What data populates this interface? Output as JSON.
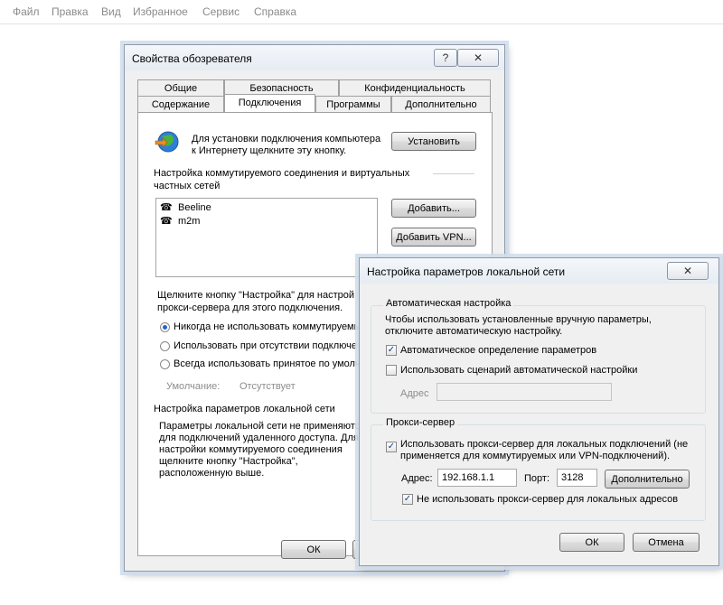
{
  "menu": [
    "Файл",
    "Правка",
    "Вид",
    "Избранное",
    "Сервис",
    "Справка"
  ],
  "main": {
    "title": "Свойства обозревателя",
    "help": "?",
    "tabs_row1": [
      "Общие",
      "Безопасность",
      "Конфиденциальность"
    ],
    "tabs_row2": [
      "Содержание",
      "Подключения",
      "Программы",
      "Дополнительно"
    ],
    "setup_text": [
      "Для установки подключения компьютера",
      "к Интернету щелкните эту кнопку."
    ],
    "setup_button": "Установить",
    "dialup_header": [
      "Настройка коммутируемого соединения и виртуальных",
      "частных сетей"
    ],
    "connections": [
      "Beeline",
      "m2m"
    ],
    "add_button": "Добавить...",
    "add_vpn_button": "Добавить VPN...",
    "proxy_hint": [
      "Щелкните кнопку \"Настройка\" для настрой",
      "прокси-сервера для этого подключения."
    ],
    "radios": [
      "Никогда не использовать коммутируемы",
      "Использовать при отсутствии подключе",
      "Всегда использовать принятое по умолча"
    ],
    "default_label": "Умолчание:",
    "default_value": "Отсутствует",
    "lan_header": "Настройка параметров локальной сети",
    "lan_text": [
      "Параметры локальной сети не применяются",
      "для подключений удаленного доступа. Для",
      "настройки коммутируемого соединения",
      "щелкните кнопку \"Настройка\",",
      "расположенную выше."
    ],
    "ok": "ОК"
  },
  "lan": {
    "title": "Настройка параметров локальной сети",
    "auto_group": "Автоматическая настройка",
    "auto_text": [
      "Чтобы использовать установленные вручную параметры,",
      "отключите автоматическую настройку."
    ],
    "auto_detect": "Автоматическое определение параметров",
    "auto_detect_checked": true,
    "use_script": "Использовать сценарий автоматической настройки",
    "use_script_checked": false,
    "address_label": "Адрес",
    "proxy_group": "Прокси-сервер",
    "use_proxy": [
      "Использовать прокси-сервер для локальных подключений (не",
      "применяется для коммутируемых или VPN-подключений)."
    ],
    "use_proxy_checked": true,
    "proxy_address_label": "Адрес:",
    "proxy_address": "192.168.1.1",
    "port_label": "Порт:",
    "port": "3128",
    "advanced_button": "Дополнительно",
    "bypass_local": "Не использовать прокси-сервер для локальных адресов",
    "bypass_local_checked": true,
    "ok": "ОК",
    "cancel": "Отмена"
  }
}
